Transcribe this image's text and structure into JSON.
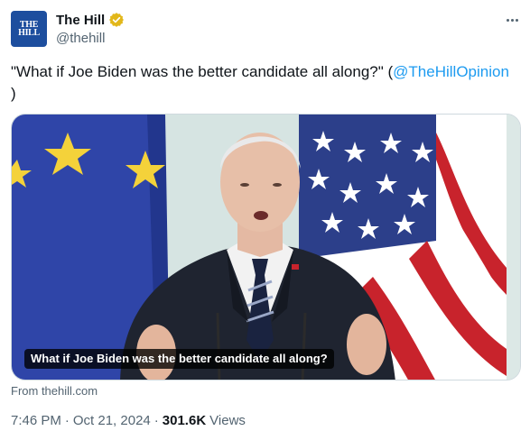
{
  "author": {
    "avatar_text": [
      "THE",
      "HILL"
    ],
    "display_name": "The Hill",
    "handle": "@thehill",
    "verified_badge": "gold-verified-badge-icon"
  },
  "more_menu": {
    "icon": "more-horizontal-icon"
  },
  "tweet": {
    "text_before": "\"What if Joe Biden was the better candidate all along?\" (",
    "mention": "@TheHillOpinion",
    "text_after": ")"
  },
  "media": {
    "caption": "What if Joe Biden was the better candidate all along?",
    "source": "From thehill.com"
  },
  "meta": {
    "time": "7:46 PM",
    "separator": "·",
    "date": "Oct 21, 2024",
    "separator2": "·",
    "views_count": "301.6K",
    "views_label": "Views"
  },
  "colors": {
    "link": "#1d9bf0",
    "secondary_text": "#536471",
    "verified_gold": "#e2b719",
    "avatar_bg": "#1d4e9e"
  }
}
